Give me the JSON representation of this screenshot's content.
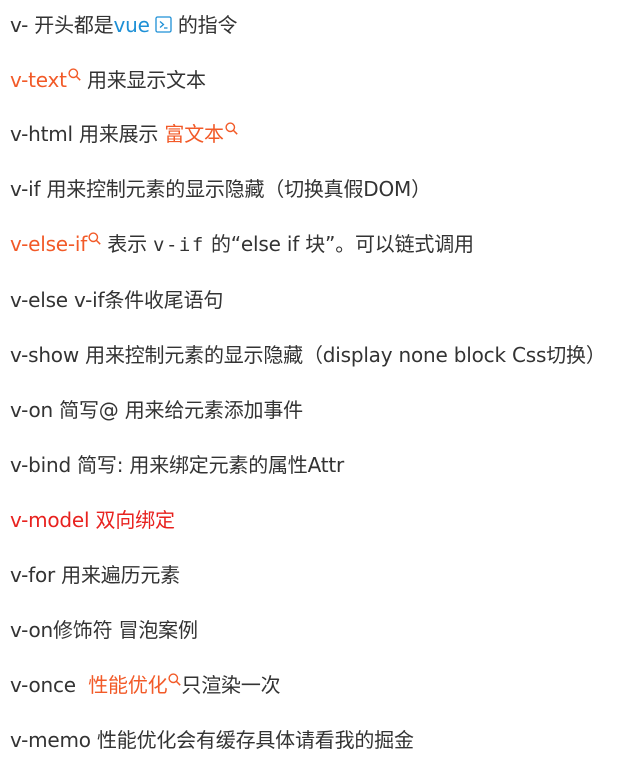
{
  "colors": {
    "text": "#333333",
    "link_orange": "#f25a28",
    "link_blue": "#1e90d6",
    "highlight_red": "#e8221f"
  },
  "lines": {
    "l1": {
      "a": "v- 开头都是",
      "link": "vue",
      "b": " 的指令"
    },
    "l2": {
      "link": "v-text",
      "b": " 用来显示文本"
    },
    "l3": {
      "a": "v-html 用来展示 ",
      "link": "富文本"
    },
    "l4": {
      "a": "v-if 用来控制元素的显示隐藏（切换真假DOM）"
    },
    "l5": {
      "link": "v-else-if",
      "b": " 表示 ",
      "code": "v-if",
      "c": " 的“else if 块”。可以链式调用"
    },
    "l6": {
      "a": "v-else v-if条件收尾语句"
    },
    "l7": {
      "a": "v-show 用来控制元素的显示隐藏（display none block Css切换）"
    },
    "l8": {
      "a": "v-on 简写@ 用来给元素添加事件"
    },
    "l9": {
      "a": "v-bind 简写:  用来绑定元素的属性Attr"
    },
    "l10": {
      "red": "v-model 双向绑定"
    },
    "l11": {
      "a": "v-for 用来遍历元素"
    },
    "l12": {
      "a": "v-on修饰符 冒泡案例"
    },
    "l13": {
      "a": "v-once  ",
      "link": "性能优化",
      "b": "只渲染一次"
    },
    "l14": {
      "a": "v-memo 性能优化会有缓存具体请看我的掘金"
    }
  },
  "icons": {
    "search": "search-icon",
    "vue_link": "external-link-icon"
  }
}
